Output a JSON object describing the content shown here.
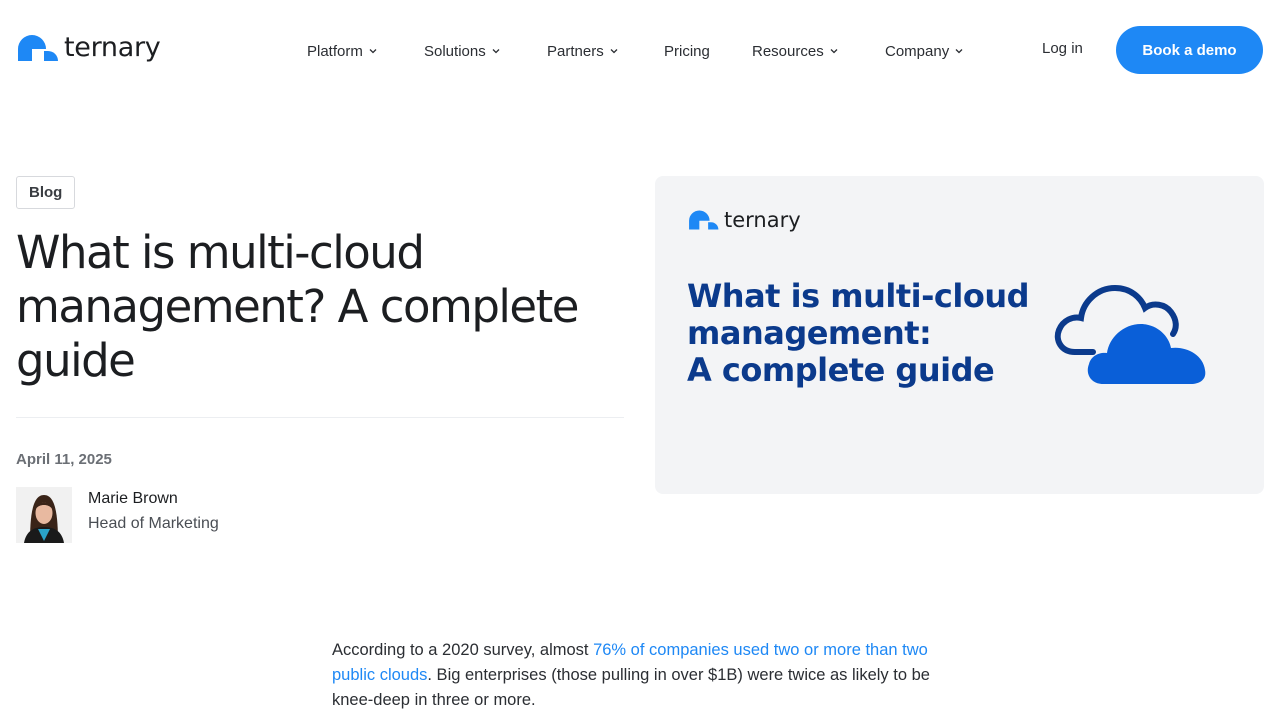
{
  "brand": {
    "name": "ternary",
    "accent": "#1e88f5",
    "navy": "#0b3a8c"
  },
  "nav": {
    "items": [
      {
        "label": "Platform",
        "has_dropdown": true
      },
      {
        "label": "Solutions",
        "has_dropdown": true
      },
      {
        "label": "Partners",
        "has_dropdown": true
      },
      {
        "label": "Pricing",
        "has_dropdown": false
      },
      {
        "label": "Resources",
        "has_dropdown": true
      },
      {
        "label": "Company",
        "has_dropdown": true
      }
    ],
    "login": "Log in",
    "cta": "Book a demo"
  },
  "article": {
    "tag": "Blog",
    "title": "What is multi-cloud management? A complete guide",
    "date": "April 11, 2025",
    "author": {
      "name": "Marie Brown",
      "role": "Head of Marketing"
    }
  },
  "card": {
    "brand": "ternary",
    "title_lines": [
      "What is multi-cloud",
      "management:",
      "A complete guide"
    ],
    "icon": "cloud-icon"
  },
  "body": {
    "p1_before": "According to a 2020 survey, almost ",
    "p1_link": "76% of companies used two or more than two public clouds",
    "p1_after": ". Big enterprises (those pulling in over $1B) were twice as likely to be knee-deep in three or more."
  }
}
